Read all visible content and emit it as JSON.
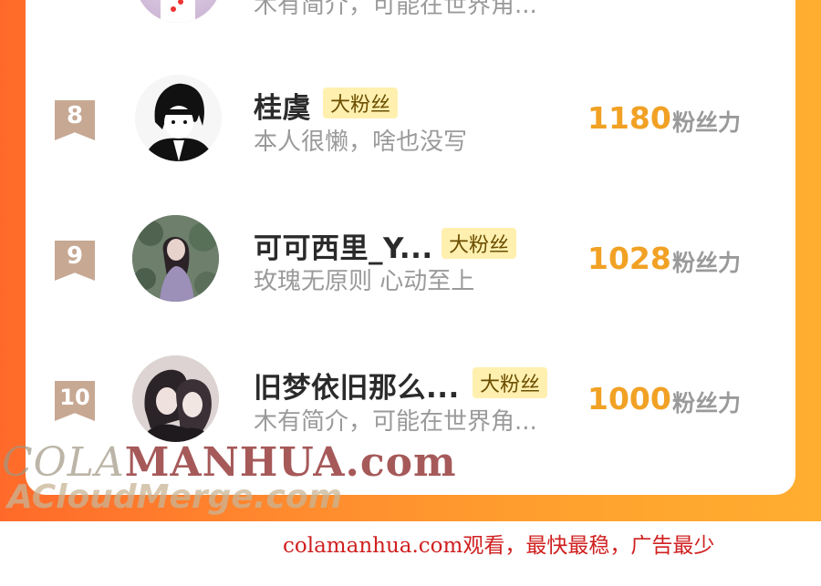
{
  "leaderboard": {
    "rows": [
      {
        "rank": "8",
        "name": "桂虞",
        "badge": "大粉丝",
        "bio": "本人很懒，啥也没写",
        "score": "1180",
        "unit": "粉丝力"
      },
      {
        "rank": "9",
        "name": "可可西里_Y...",
        "badge": "大粉丝",
        "bio": "玫瑰无原则 心动至上",
        "score": "1028",
        "unit": "粉丝力"
      },
      {
        "rank": "10",
        "name": "旧梦依旧那么...",
        "badge": "大粉丝",
        "bio": "木有简介，可能在世界角...",
        "score": "1000",
        "unit": "粉丝力"
      }
    ],
    "partial_top_bio": "木有简介，可能在世界角..."
  },
  "watermark": {
    "line1_prefix": "COLA",
    "line1_rest": "MANHUA.com",
    "line2": "ACloudMerge.com"
  },
  "footer": {
    "text": "colamanhua.com观看，最快最稳，广告最少"
  },
  "colors": {
    "accent_gradient_start": "#ff6a2a",
    "accent_gradient_end": "#ffae30",
    "score": "#f1a124",
    "badge_bg": "#fff0b0",
    "rank_badge": "#c7a893"
  }
}
